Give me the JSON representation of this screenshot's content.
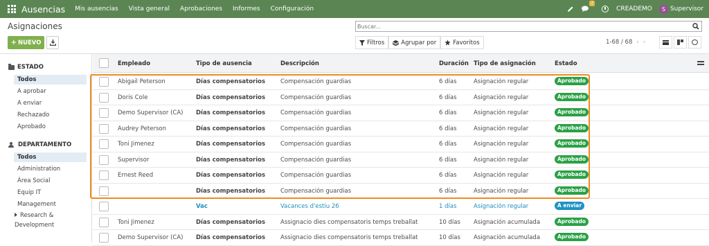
{
  "navbar": {
    "app_name": "Ausencias",
    "menu": [
      "Mis ausencias",
      "Vista general",
      "Aprobaciones",
      "Informes",
      "Configuración"
    ],
    "chat_count": "7",
    "company": "CREADEMO",
    "user_initial": "S",
    "user_name": "Supervisor"
  },
  "control_panel": {
    "title": "Asignaciones",
    "new_button": "NUEVO",
    "search_placeholder": "Buscar...",
    "filters_label": "Filtros",
    "group_by_label": "Agrupar por",
    "favorites_label": "Favoritos",
    "pager": "1-68 / 68"
  },
  "sidebar": {
    "state_header": "ESTADO",
    "state_items": [
      "Todos",
      "A aprobar",
      "A enviar",
      "Rechazado",
      "Aprobado"
    ],
    "department_header": "DEPARTAMENTO",
    "department_items": [
      "Todos",
      "Administration",
      "Área Social",
      "Equip IT",
      "Management",
      "Research & Development"
    ]
  },
  "table": {
    "columns": {
      "employee": "Empleado",
      "leave_type": "Tipo de ausencia",
      "description": "Descripción",
      "duration": "Duración",
      "allocation_type": "Tipo de asignación",
      "state": "Estado"
    },
    "rows": [
      {
        "employee": "Abigail Peterson",
        "leave_type": "Días compensatorios",
        "description": "Compensación guardias",
        "duration": "6 días",
        "allocation_type": "Asignación regular",
        "state": "Aprobado"
      },
      {
        "employee": "Doris Cole",
        "leave_type": "Días compensatorios",
        "description": "Compensación guardias",
        "duration": "6 días",
        "allocation_type": "Asignación regular",
        "state": "Aprobado"
      },
      {
        "employee": "Demo Supervisor (CA)",
        "leave_type": "Días compensatorios",
        "description": "Compensación guardias",
        "duration": "6 días",
        "allocation_type": "Asignación regular",
        "state": "Aprobado"
      },
      {
        "employee": "Audrey Peterson",
        "leave_type": "Días compensatorios",
        "description": "Compensación guardias",
        "duration": "6 días",
        "allocation_type": "Asignación regular",
        "state": "Aprobado"
      },
      {
        "employee": "Toni Jimenez",
        "leave_type": "Días compensatorios",
        "description": "Compensación guardias",
        "duration": "6 días",
        "allocation_type": "Asignación regular",
        "state": "Aprobado"
      },
      {
        "employee": "Supervisor",
        "leave_type": "Días compensatorios",
        "description": "Compensación guardias",
        "duration": "6 días",
        "allocation_type": "Asignación regular",
        "state": "Aprobado"
      },
      {
        "employee": "Ernest Reed",
        "leave_type": "Días compensatorios",
        "description": "Compensación guardias",
        "duration": "6 días",
        "allocation_type": "Asignación regular",
        "state": "Aprobado"
      },
      {
        "employee": "",
        "leave_type": "Días compensatorios",
        "description": "Compensación guardias",
        "duration": "6 días",
        "allocation_type": "Asignación regular",
        "state": "Aprobado"
      },
      {
        "employee": "",
        "leave_type": "Vac",
        "description": "Vacances d'estiu 26",
        "duration": "1 días",
        "allocation_type": "Asignación regular",
        "state": "A enviar"
      },
      {
        "employee": "Toni Jimenez",
        "leave_type": "Días compensatorios",
        "description": "Assignacio dies compensatoris temps treballat",
        "duration": "10 días",
        "allocation_type": "Asignación acumulada",
        "state": "Aprobado"
      },
      {
        "employee": "Demo Supervisor (CA)",
        "leave_type": "Días compensatorios",
        "description": "Assignacio dies compensatoris temps treballat",
        "duration": "10 días",
        "allocation_type": "Asignación acumulada",
        "state": "Aprobado"
      }
    ]
  },
  "colors": {
    "navbar": "#5b8654",
    "new_button": "#7fb04d",
    "approved_badge": "#2aa145",
    "to_submit_badge": "#1d93c3",
    "highlight": "#ef8a1f"
  }
}
